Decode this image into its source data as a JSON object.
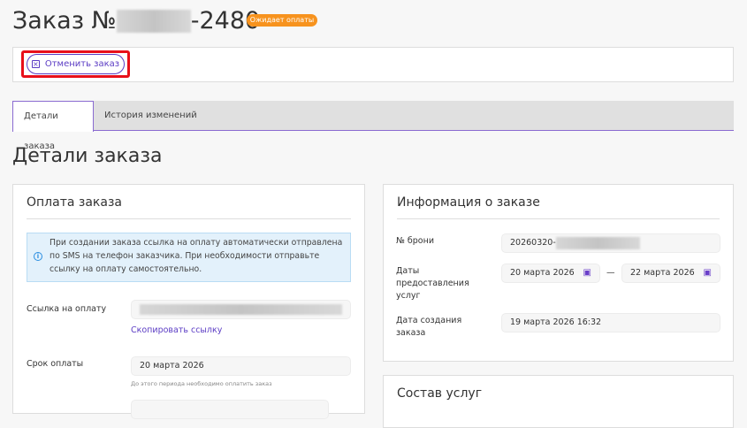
{
  "header": {
    "title_prefix": "Заказ №",
    "title_suffix": "-2480",
    "status_badge": "Ожидает оплаты"
  },
  "actions": {
    "cancel_label": "Отменить заказ"
  },
  "tabs": [
    {
      "label": "Детали заказа",
      "active": true
    },
    {
      "label": "История изменений",
      "active": false
    }
  ],
  "section_title": "Детали заказа",
  "payment": {
    "title": "Оплата заказа",
    "info": "При создании заказа ссылка на оплату автоматически отправлена по SMS на телефон заказчика. При необходимости отправьте ссылку на оплату самостоятельно.",
    "link_label": "Ссылка на оплату",
    "copy_link": "Скопировать ссылку",
    "deadline_label": "Срок оплаты",
    "deadline_value": "20 марта 2026",
    "deadline_hint": "До этого периода необходимо оплатить заказ"
  },
  "order_info": {
    "title": "Информация о заказе",
    "booking_label": "№ брони",
    "booking_value": "20260320-",
    "dates_label": "Даты предоставления услуг",
    "date_from": "20 марта 2026",
    "date_separator": "—",
    "date_to": "22 марта 2026",
    "created_label": "Дата создания заказа",
    "created_value": "19 марта 2026 16:32"
  },
  "services": {
    "title": "Состав услуг"
  }
}
